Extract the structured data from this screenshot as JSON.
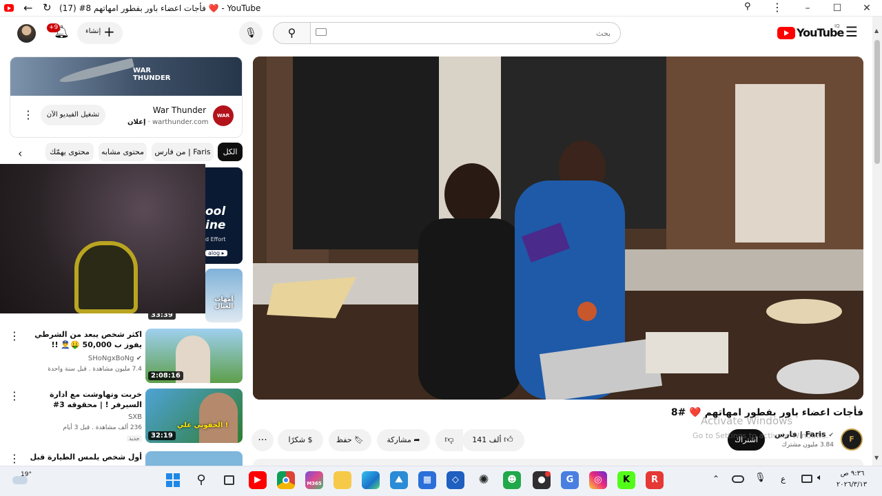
{
  "window": {
    "title": "(17) #8 فأجات اعضاء باور بفطور امهاتهم ❤️ - YouTube",
    "controls": {
      "minimize": "–",
      "maximize": "☐",
      "close": "✕"
    }
  },
  "masthead": {
    "logo_text": "YouTube",
    "country": "IQ",
    "search_placeholder": "بحث",
    "create_label": "إنشاء",
    "notification_badge": "+9"
  },
  "ad": {
    "brand": "War Thunder",
    "domain": "warthunder.com",
    "sponsored": "إعلان",
    "cta": "تشغيل الفيديو الآن",
    "banner_logo": "WAR THUNDER"
  },
  "chips": [
    {
      "label": "الكل",
      "active": true
    },
    {
      "label": "من فارس | Faris",
      "active": false
    },
    {
      "label": "محتوى مشابه",
      "active": false
    },
    {
      "label": "محتوى يهمّك",
      "active": false
    }
  ],
  "related": [
    {
      "title": "",
      "meta": "",
      "duration": ""
    },
    {
      "title": "",
      "meta": "",
      "duration": "33:39"
    },
    {
      "title": "اكثر شخص يبعد من الشرطي يفوز ب 50,000 🤑👮‍♂️ !!",
      "channel": "SHoNgxBoNg",
      "views": "7.4 مليون مشاهدة",
      "age": "قبل سنة واحدة",
      "duration": "2:08:16"
    },
    {
      "title": "خربت وتهاوشت مع ادارة السيرفر ! | محقوقه 3#",
      "channel": "SXB",
      "views": "236 ألف مشاهدة",
      "age": "قبل 3 أيام",
      "badge": "جديد",
      "duration": "32:19"
    },
    {
      "title": "أول شخص يلمس الطيارة قبل وصولها يفوز",
      "channel": "",
      "views": "",
      "age": "",
      "duration": ""
    }
  ],
  "thumb_texts": {
    "r1": "ool ine",
    "r1b": "d Effort",
    "r1c": "alog ▸",
    "r2": "أمهات العيال",
    "r4": "الحقوني علي !"
  },
  "video": {
    "title": "فأجات اعضاء باور بفطور امهاتهم ❤️ #8",
    "channel": "فارس | Faris",
    "subscribers": "3.84 مليون مشترك",
    "subscribe_label": "اشتراك",
    "likes": "141 ألف",
    "share": "مشاركة",
    "save": "حفظ",
    "thanks": "شكرًا",
    "watermark_line1": "Activate Windows",
    "watermark_line2": "Go to Settings to activate Windows."
  },
  "taskbar": {
    "weather_temp": "19°",
    "time": "٩:٣٦ ص",
    "date": "٢٠٢٦/٣/١٣",
    "lang": "ع",
    "apps": [
      "windows-start",
      "search",
      "task-view",
      "youtube",
      "chrome",
      "m365",
      "file-explorer",
      "edge",
      "photos",
      "store",
      "codeapp",
      "chatgpt",
      "whatsapp-bot",
      "obs",
      "translate",
      "instagram",
      "kick",
      "roblox"
    ]
  },
  "colors": {
    "yt_red": "#ff0000",
    "accent": "#0f0f0f",
    "chip_bg": "#f2f2f2",
    "taskbar": "#eef2f7"
  }
}
